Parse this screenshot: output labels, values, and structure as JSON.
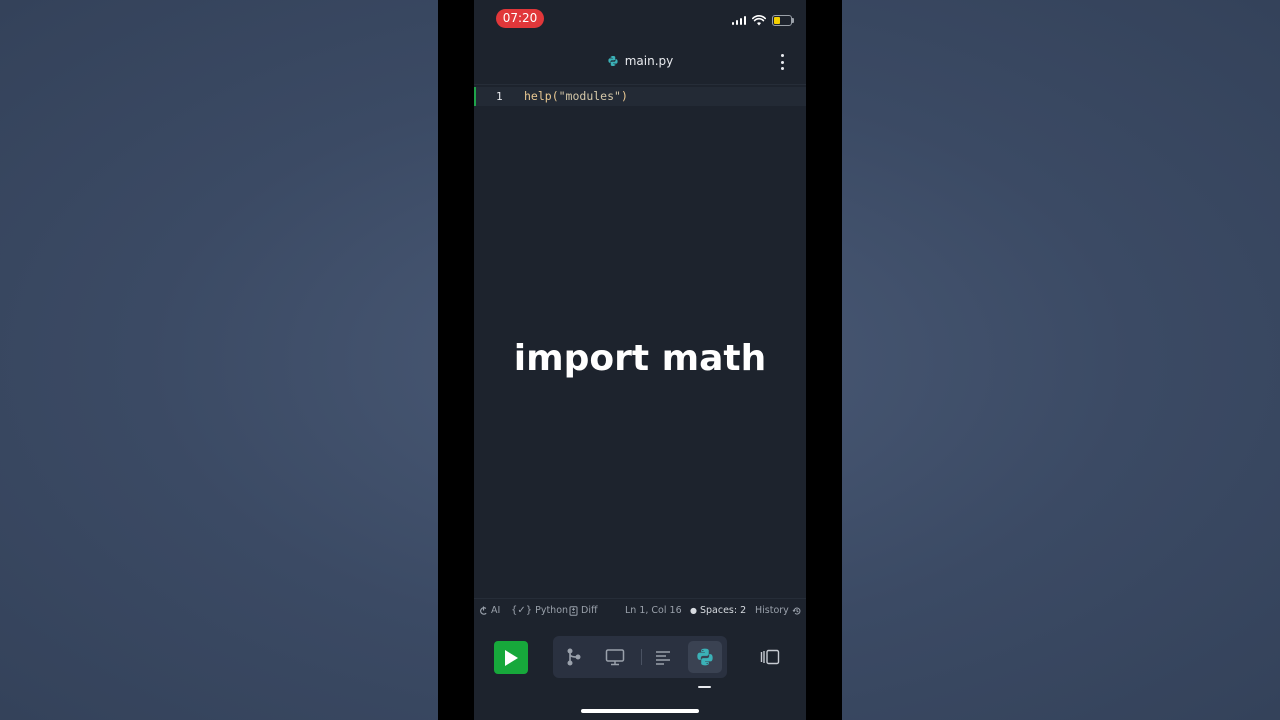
{
  "status_bar": {
    "time": "07:20",
    "time_pill_color": "#e1373a",
    "battery_color": "#f5d000"
  },
  "header": {
    "file_name": "main.py",
    "file_icon": "python-icon",
    "menu_icon": "more-vertical-icon"
  },
  "editor": {
    "lines": [
      {
        "number": "1",
        "code_fn": "help(",
        "code_str": "\"modules\"",
        "code_end": ")"
      }
    ],
    "active_line_color": "#1fa34a"
  },
  "overlay": {
    "caption": "import math"
  },
  "footer": {
    "ai_label": "AI",
    "language_label": "Python",
    "diff_label": "Diff",
    "cursor_position": "Ln 1, Col 16",
    "indent_label": "Spaces: 2",
    "history_label": "History"
  },
  "toolbar": {
    "run_color": "#17a83b",
    "tools": [
      "git-branch-icon",
      "monitor-icon",
      "align-left-icon",
      "python-icon"
    ],
    "active_tool": "python-icon",
    "layout_icon": "split-layout-icon"
  }
}
